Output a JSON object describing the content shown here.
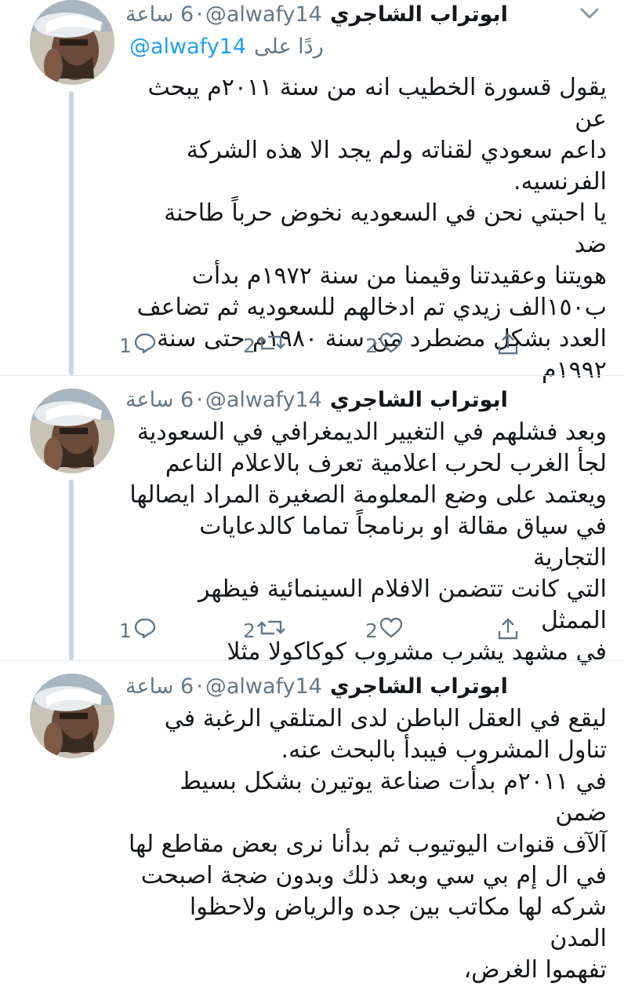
{
  "tweets": [
    {
      "display_name": "ابوتراب الشاجري",
      "handle": "@alwafy14",
      "dot": "·",
      "time": "6 ساعة",
      "reply_prefix": "ردًا على",
      "reply_handle": "@alwafy14",
      "text": "يقول قسورة الخطيب انه من سنة ٢٠١١م يبحث عن\nداعم سعودي لقناته ولم يجد الا هذه الشركة\nالفرنسيه.\nيا احبتي نحن في السعوديه نخوض حرباً طاحنة ضد\nهويتنا وعقيدتنا وقيمنا من سنة ١٩٧٢م بدأت\nب١٥٠الف زيدي تم ادخالهم للسعوديه ثم تضاعف\nالعدد بشكل مضطرد من سنة ١٩٨٠م حتى سنة\n١٩٩٢م",
      "reply_count": "1",
      "retweet_count": "2",
      "like_count": "2"
    },
    {
      "display_name": "ابوتراب الشاجري",
      "handle": "@alwafy14",
      "dot": "·",
      "time": "6 ساعة",
      "text": "وبعد فشلهم في التغيير الديمغرافي في السعودية\nلجأ الغرب لحرب اعلامية تعرف بالاعلام الناعم\nويعتمد على وضع المعلومة الصغيرة المراد ايصالها\nفي سياق مقالة او برنامجاً تماما كالدعايات التجارية\nالتي كانت تتضمن الافلام السينمائية فيظهر الممثل\nفي مشهد يشرب مشروب كوكاكولا مثلا",
      "reply_count": "1",
      "retweet_count": "2",
      "like_count": "2"
    },
    {
      "display_name": "ابوتراب الشاجري",
      "handle": "@alwafy14",
      "dot": "·",
      "time": "6 ساعة",
      "text": "ليقع في العقل الباطن لدى المتلقي الرغبة في\nتناول المشروب فيبدأ بالبحث عنه.\nفي ٢٠١١م بدأت صناعة يوتيرن بشكل بسيط ضمن\nآلآف قنوات اليوتيوب ثم بدأنا نرى بعض مقاطع لها\nفي ال إم بي سي وبعد ذلك وبدون ضجة اصبحت\nشركه لها مكاتب بين جده والرياض ولاحظوا المدن\nتفهموا الغرض،"
    }
  ],
  "colors": {
    "accent": "#1da1f2",
    "secondary_text": "#657786",
    "thread_line": "#ccd6dd"
  },
  "icons": [
    "reply-icon",
    "retweet-icon",
    "like-icon",
    "share-icon",
    "chevron-down-icon"
  ]
}
